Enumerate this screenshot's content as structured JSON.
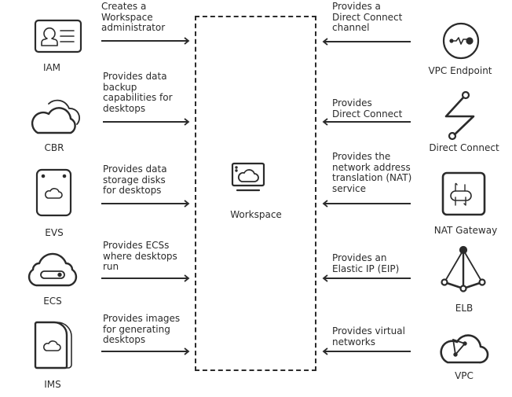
{
  "center": {
    "label": "Workspace",
    "icon": "workspace-desktop-cloud-icon"
  },
  "left_services": [
    {
      "name": "IAM",
      "icon": "id-card-icon",
      "description": "Creates a\nWorkspace\nadministrator"
    },
    {
      "name": "CBR",
      "icon": "cloud-backup-icon",
      "description": "Provides data\nbackup\ncapabilities for\ndesktops"
    },
    {
      "name": "EVS",
      "icon": "disk-cloud-icon",
      "description": "Provides data\nstorage disks\nfor desktops"
    },
    {
      "name": "ECS",
      "icon": "cloud-server-icon",
      "description": "Provides ECSs\nwhere desktops\nrun"
    },
    {
      "name": "IMS",
      "icon": "image-file-cloud-icon",
      "description": "Provides images\nfor generating\ndesktops"
    }
  ],
  "right_services": [
    {
      "name": "VPC Endpoint",
      "icon": "endpoint-circle-icon",
      "description": "Provides a\nDirect Connect\nchannel"
    },
    {
      "name": "Direct Connect",
      "icon": "direct-connect-zigzag-icon",
      "description": "Provides\nDirect Connect"
    },
    {
      "name": "NAT Gateway",
      "icon": "nat-gateway-icon",
      "description": "Provides the\nnetwork address\ntranslation (NAT)\nservice"
    },
    {
      "name": "ELB",
      "icon": "load-balancer-icon",
      "description": "Provides an\nElastic IP (EIP)"
    },
    {
      "name": "VPC",
      "icon": "vpc-cloud-icon",
      "description": "Provides virtual\nnetworks"
    }
  ],
  "colors": {
    "stroke": "#2b2b2b",
    "background": "#ffffff"
  }
}
